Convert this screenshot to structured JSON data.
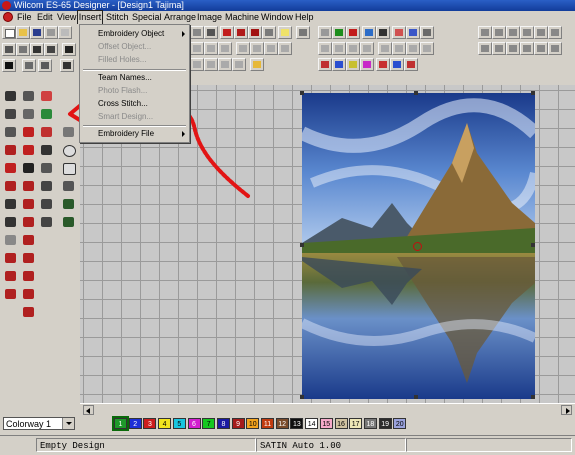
{
  "window": {
    "title": "Wilcom ES-65 Designer - [Design1     Tajima]"
  },
  "menubar": {
    "items": [
      "File",
      "Edit",
      "View",
      "Insert",
      "Stitch",
      "Special",
      "Arrange",
      "Image",
      "Machine",
      "Window",
      "Help"
    ],
    "active": "Insert"
  },
  "insert_menu": {
    "items": [
      {
        "label": "Embroidery Object",
        "enabled": true,
        "submenu": true
      },
      {
        "label": "Offset Object...",
        "enabled": false
      },
      {
        "label": "Filled Holes...",
        "enabled": false
      },
      {
        "label": "Team Names...",
        "enabled": true
      },
      {
        "label": "Photo Flash...",
        "enabled": false
      },
      {
        "label": "Cross Stitch...",
        "enabled": true
      },
      {
        "label": "Smart Design...",
        "enabled": false
      },
      {
        "label": "Embroidery File",
        "enabled": true,
        "submenu": true
      }
    ]
  },
  "colorway": {
    "selected": "Colorway 1"
  },
  "palette": {
    "swatches": [
      {
        "n": "1",
        "color": "#1f9a2a",
        "active": true
      },
      {
        "n": "2",
        "color": "#1c2fd6"
      },
      {
        "n": "3",
        "color": "#cc1d1d"
      },
      {
        "n": "4",
        "color": "#f2e41e"
      },
      {
        "n": "5",
        "color": "#18c5e0"
      },
      {
        "n": "6",
        "color": "#d21fd0"
      },
      {
        "n": "7",
        "color": "#14c81e"
      },
      {
        "n": "8",
        "color": "#1a1aa2"
      },
      {
        "n": "9",
        "color": "#a51c1c"
      },
      {
        "n": "10",
        "color": "#f3a31e"
      },
      {
        "n": "11",
        "color": "#c03a0e"
      },
      {
        "n": "12",
        "color": "#7a4b2a"
      },
      {
        "n": "13",
        "color": "#101010"
      },
      {
        "n": "14",
        "color": "#ffffff"
      },
      {
        "n": "15",
        "color": "#f5a9c9"
      },
      {
        "n": "16",
        "color": "#cfc1a0"
      },
      {
        "n": "17",
        "color": "#ede6b6"
      },
      {
        "n": "18",
        "color": "#777777"
      },
      {
        "n": "19",
        "color": "#2c2c2c"
      },
      {
        "n": "20",
        "color": "#9aa2dc"
      }
    ]
  },
  "status": {
    "design": "Empty Design",
    "stitch": "SATIN Auto  1.00"
  },
  "colors": {
    "annotation": "#e21414",
    "menu_highlight": "#0a246a"
  }
}
